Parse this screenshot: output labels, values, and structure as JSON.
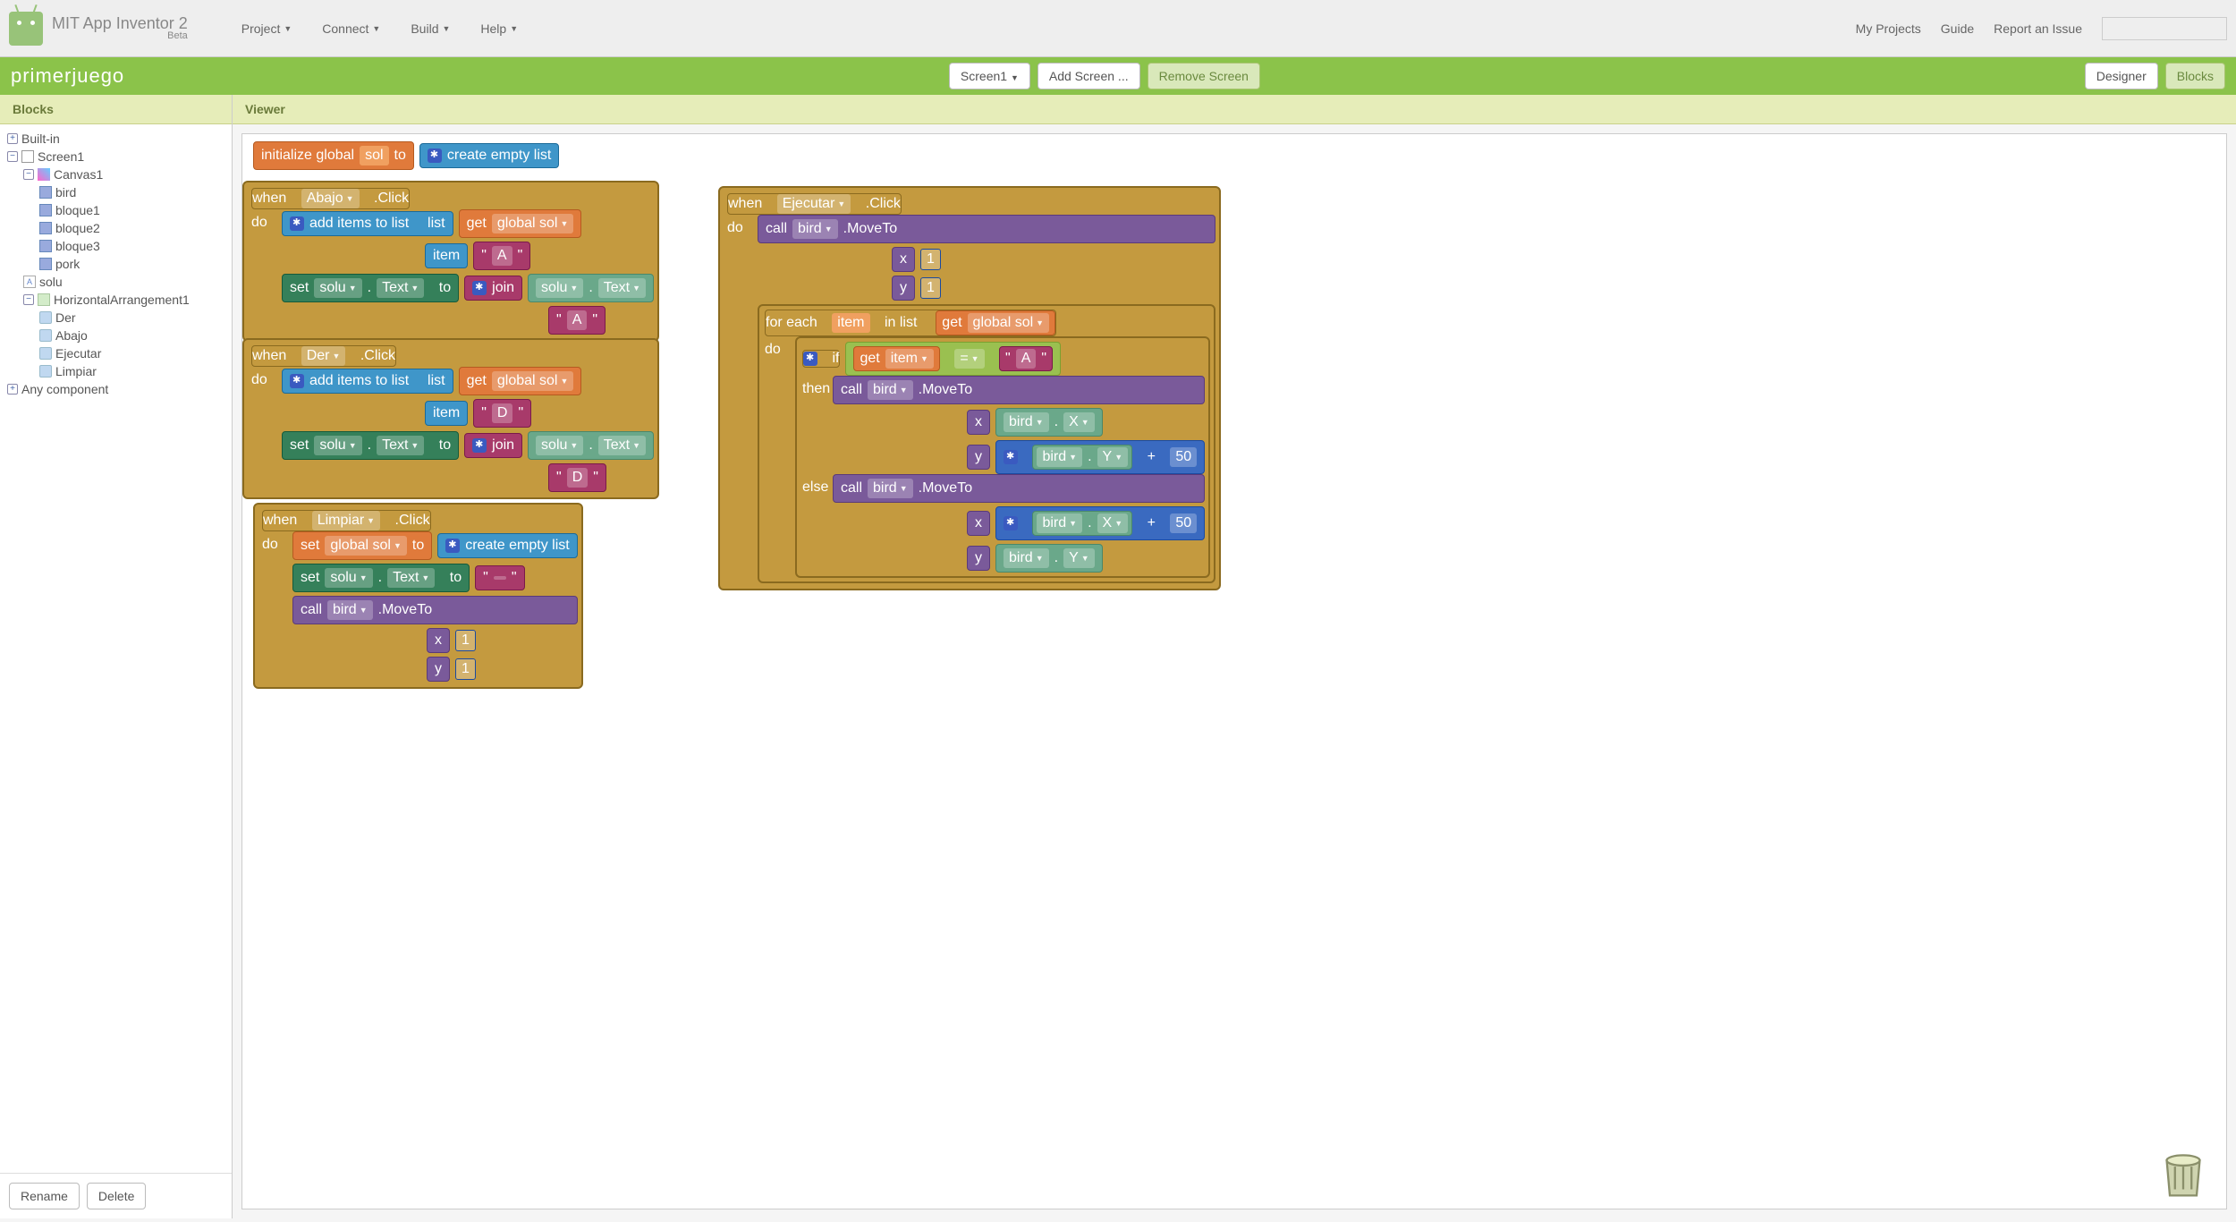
{
  "header": {
    "title": "MIT App Inventor 2",
    "beta": "Beta",
    "menu": [
      "Project",
      "Connect",
      "Build",
      "Help"
    ],
    "right_menu": [
      "My Projects",
      "Guide",
      "Report an Issue"
    ]
  },
  "greenbar": {
    "project": "primerjuego",
    "screen_sel": "Screen1",
    "add_screen": "Add Screen ...",
    "remove_screen": "Remove Screen",
    "designer": "Designer",
    "blocks": "Blocks"
  },
  "sidebar": {
    "title": "Blocks",
    "builtin": "Built-in",
    "screen": "Screen1",
    "canvas": "Canvas1",
    "sprites": [
      "bird",
      "bloque1",
      "bloque2",
      "bloque3",
      "pork"
    ],
    "label_solu": "solu",
    "horiz": "HorizontalArrangement1",
    "buttons": [
      "Der",
      "Abajo",
      "Ejecutar",
      "Limpiar"
    ],
    "any_comp": "Any component",
    "rename": "Rename",
    "delete": "Delete"
  },
  "viewer": {
    "title": "Viewer",
    "init": {
      "kw": "initialize global",
      "var": "sol",
      "to": "to",
      "list": "create empty list"
    },
    "when": "when",
    "do": "do",
    "click": ".Click",
    "add_items": "add items to list",
    "list_lbl": "list",
    "item_lbl": "item",
    "get": "get",
    "global_sol": "global sol",
    "set": "set",
    "solu": "solu",
    "text_prop": "Text",
    "to_lbl": "to",
    "join": "join",
    "call": "call",
    "bird": "bird",
    "moveto": ".MoveTo",
    "x": "x",
    "y": "y",
    "foreach": "for each",
    "item": "item",
    "inlist": "in list",
    "if": "if",
    "then": "then",
    "else": "else",
    "eq": "=",
    "X": "X",
    "Y": "Y",
    "plus": "+",
    "fifty": "50",
    "one": "1",
    "A": "A",
    "D": "D",
    "empty": "",
    "abajo": "Abajo",
    "der": "Der",
    "limpiar": "Limpiar",
    "ejecutar": "Ejecutar"
  }
}
